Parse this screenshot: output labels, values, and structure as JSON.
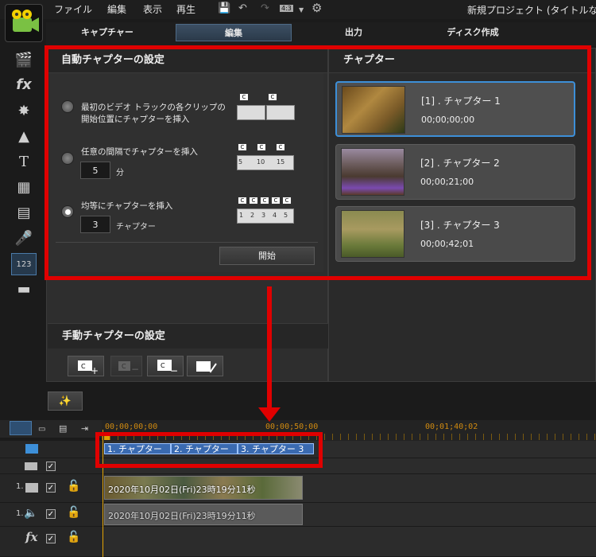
{
  "menu": {
    "file": "ファイル",
    "edit": "編集",
    "view": "表示",
    "play": "再生",
    "aspect": "4:3"
  },
  "title": "新規プロジェクト (タイトルな",
  "tabs": {
    "capture": "キャプチャー",
    "edit": "編集",
    "output": "出力",
    "disc": "ディスク作成"
  },
  "auto": {
    "header": "自動チャプターの設定",
    "opt1": "最初のビデオ トラックの各クリップの\n開始位置にチャプターを挿入",
    "opt2": "任意の間隔でチャプターを挿入",
    "opt2_value": "5",
    "opt2_unit": "分",
    "opt3": "均等にチャプターを挿入",
    "opt3_value": "3",
    "opt3_unit": "チャプター",
    "start_button": "開始",
    "flag_c": "C",
    "diag2_nums": [
      "5",
      "10",
      "15"
    ],
    "diag3_nums": [
      "1",
      "2",
      "3",
      "4",
      "5"
    ]
  },
  "manual": {
    "header": "手動チャプターの設定"
  },
  "chapters": {
    "header": "チャプター",
    "items": [
      {
        "label": "[1] . チャプター 1",
        "time": "00;00;00;00"
      },
      {
        "label": "[2] . チャプター 2",
        "time": "00;00;21;00"
      },
      {
        "label": "[3] . チャプター 3",
        "time": "00;00;42;01"
      }
    ]
  },
  "timeline": {
    "ruler": [
      "00;00;00;00",
      "00;00;50;00",
      "00;01;40;02"
    ],
    "chapter_segments": [
      "1. チャプター",
      "2. チャプター",
      "3. チャプター 3"
    ],
    "video_clip": "2020年10月02日(Fri)23時19分11秒",
    "audio_clip": "2020年10月02日(Fri)23時19分11秒",
    "track1": "1.",
    "track2": "1.",
    "fx": "fx"
  },
  "colors": {
    "accent": "#3d8fd8",
    "annotation": "#e00000",
    "timecode": "#d08a10"
  }
}
